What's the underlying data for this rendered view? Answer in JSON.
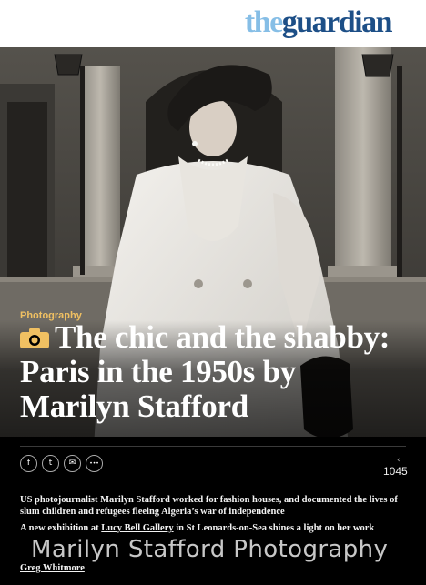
{
  "masthead": {
    "logo_the": "the",
    "logo_guardian": "guardian"
  },
  "article": {
    "section": "Photography",
    "headline": "The chic and the shabby: Paris in the 1950s by Marilyn Stafford",
    "headline_icon": "camera-icon",
    "standfirst_1": "US photojournalist Marilyn Stafford worked for fashion houses, and documented the lives of slum children and refugees fleeing Algeria’s war of independence",
    "standfirst_2_before": "A new exhibition at ",
    "standfirst_2_link": "Lucy Bell Gallery",
    "standfirst_2_after": " in St Leonards-on-Sea shines a light on her work",
    "byline": "Greg Whitmore"
  },
  "share": {
    "buttons": [
      {
        "name": "facebook-icon",
        "glyph": "f"
      },
      {
        "name": "twitter-icon",
        "glyph": "t"
      },
      {
        "name": "email-icon",
        "glyph": "✉"
      },
      {
        "name": "more-icon",
        "glyph": "•••"
      }
    ],
    "count_icon": "share-icon",
    "count": "1045"
  },
  "watermark": "Marilyn Stafford Photography",
  "colors": {
    "section_label": "#f0c062",
    "logo_the": "#86bee6",
    "logo_guardian": "#1d4f87"
  }
}
